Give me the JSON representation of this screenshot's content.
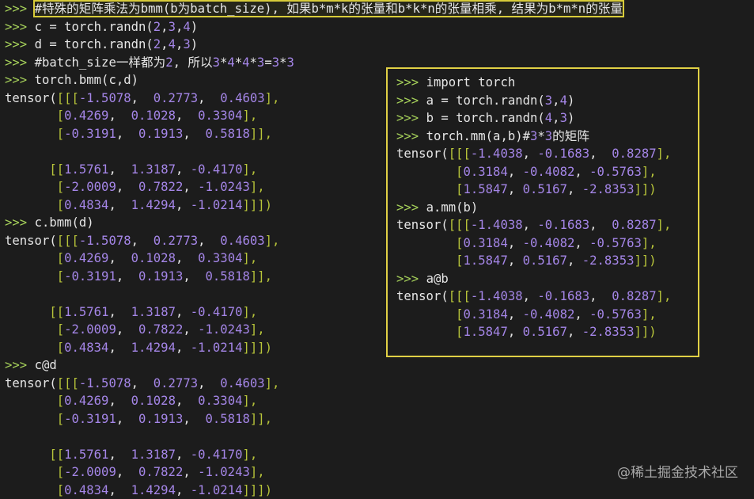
{
  "main": {
    "l0": {
      "p": ">>> ",
      "t": "#特殊的矩阵乘法为bmm(b为batch_size), 如果b*m*k的张量和b*k*n的张量相乘, 结果为b*m*n的张量"
    },
    "l1": {
      "p": ">>> ",
      "a": "c = torch.randn(",
      "b": "2",
      "c": ",",
      "d": "3",
      "e": ",",
      "f": "4",
      "g": ")"
    },
    "l2": {
      "p": ">>> ",
      "a": "d = torch.randn(",
      "b": "2",
      "c": ",",
      "d": "4",
      "e": ",",
      "f": "3",
      "g": ")"
    },
    "l3": {
      "p": ">>> ",
      "a": "#batch_size一样都为",
      "b": "2",
      "c": ", 所以",
      "d": "3",
      "e": "*",
      "f": "4",
      "g": "*",
      "h": "4",
      "i": "*",
      "j": "3",
      "k": "=",
      "l": "3",
      "m": "*",
      "n": "3"
    },
    "l4": {
      "p": ">>> ",
      "t": "torch.bmm(c,d)"
    },
    "t1": {
      "pre": "tensor(",
      "ob": "[[[",
      "r": [
        "-1.5078",
        "0.2773",
        "0.4603"
      ]
    },
    "rowsA": [
      {
        "ob": "[",
        "v": [
          "0.4269",
          "0.1028",
          "0.3304"
        ],
        "cb": "],"
      },
      {
        "ob": "[",
        "v": [
          "-0.3191",
          "0.1913",
          "0.5818"
        ],
        "cb": "]],"
      }
    ],
    "rowsB": [
      {
        "ob": "[[",
        "v": [
          "1.5761",
          "1.3187",
          "-0.4170"
        ],
        "cb": "],"
      },
      {
        "ob": "[",
        "v": [
          "-2.0009",
          "0.7822",
          "-1.0243"
        ],
        "cb": "],"
      },
      {
        "ob": "[",
        "v": [
          "0.4834",
          "1.4294",
          "-1.0214"
        ],
        "cb": "]]])"
      }
    ],
    "l_cbmm": {
      "p": ">>> ",
      "t": "c.bmm(d)"
    },
    "l_cat": {
      "p": ">>> ",
      "t": "c@d"
    },
    "first_close": "],"
  },
  "box": {
    "l0": {
      "p": ">>> ",
      "t": "import torch"
    },
    "l1": {
      "p": ">>> ",
      "a": "a = torch.randn(",
      "b": "3",
      "c": ",",
      "d": "4",
      "e": ")"
    },
    "l2": {
      "p": ">>> ",
      "a": "b = torch.randn(",
      "b": "4",
      "c": ",",
      "d": "3",
      "e": ")"
    },
    "l3": {
      "p": ">>> ",
      "a": "torch.mm(a,b)#",
      "b": "3",
      "c": "*",
      "d": "3",
      "e": "的矩阵"
    },
    "r1": [
      "-1.4038",
      "-0.1683",
      "0.8287"
    ],
    "r2": [
      "0.3184",
      "-0.4082",
      "-0.5763"
    ],
    "r3": [
      "1.5847",
      "0.5167",
      "-2.8353"
    ],
    "l_amm": {
      "p": ">>> ",
      "t": "a.mm(b)"
    },
    "l_at": {
      "p": ">>> ",
      "t": "a@b"
    },
    "tensor_pre": "tensor(",
    "ob2": "[[",
    "ob1": "[",
    "cb1": "],",
    "cb_end": "]])"
  },
  "watermark": "@稀土掘金技术社区"
}
